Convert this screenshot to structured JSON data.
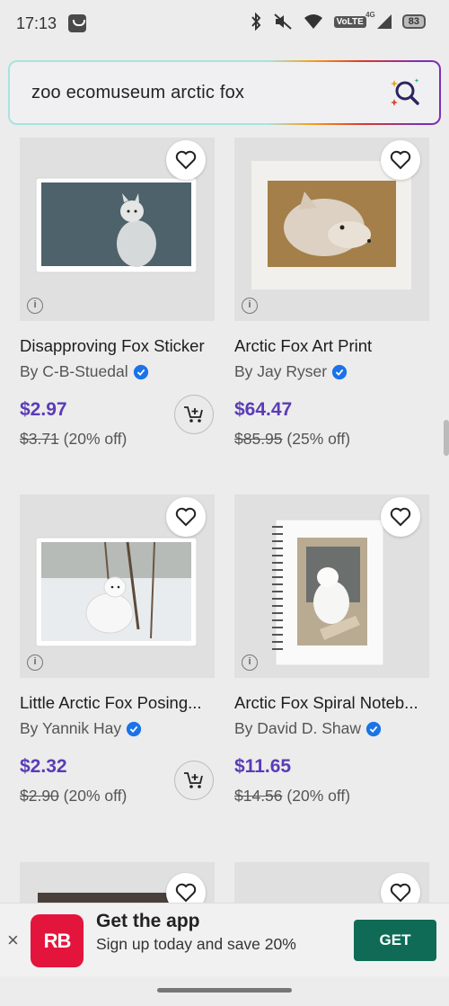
{
  "status": {
    "time": "17:13",
    "volte": "VoLTE",
    "network": "4G",
    "battery": "83"
  },
  "search": {
    "query": "zoo ecomuseum arctic fox"
  },
  "products": [
    {
      "title": "Disapproving Fox Sticker",
      "artist": "By C-B-Stuedal",
      "price": "$2.97",
      "original": "$3.71",
      "discount": "(20% off)",
      "has_cart": true
    },
    {
      "title": "Arctic Fox Art Print",
      "artist": "By Jay Ryser",
      "price": "$64.47",
      "original": "$85.95",
      "discount": "(25% off)",
      "has_cart": false
    },
    {
      "title": "Little Arctic Fox Posing...",
      "artist": "By Yannik Hay",
      "price": "$2.32",
      "original": "$2.90",
      "discount": "(20% off)",
      "has_cart": true
    },
    {
      "title": "Arctic Fox Spiral Noteb...",
      "artist": "By David D. Shaw",
      "price": "$11.65",
      "original": "$14.56",
      "discount": "(20% off)",
      "has_cart": false
    }
  ],
  "banner": {
    "logo_text": "RB",
    "title": "Get the app",
    "subtitle": "Sign up today and save 20%",
    "cta": "GET",
    "close": "×"
  },
  "colors": {
    "price": "#5a3bb7",
    "cta_bg": "#0f6b55",
    "logo_bg": "#e4153d",
    "verified": "#1a73e8"
  }
}
